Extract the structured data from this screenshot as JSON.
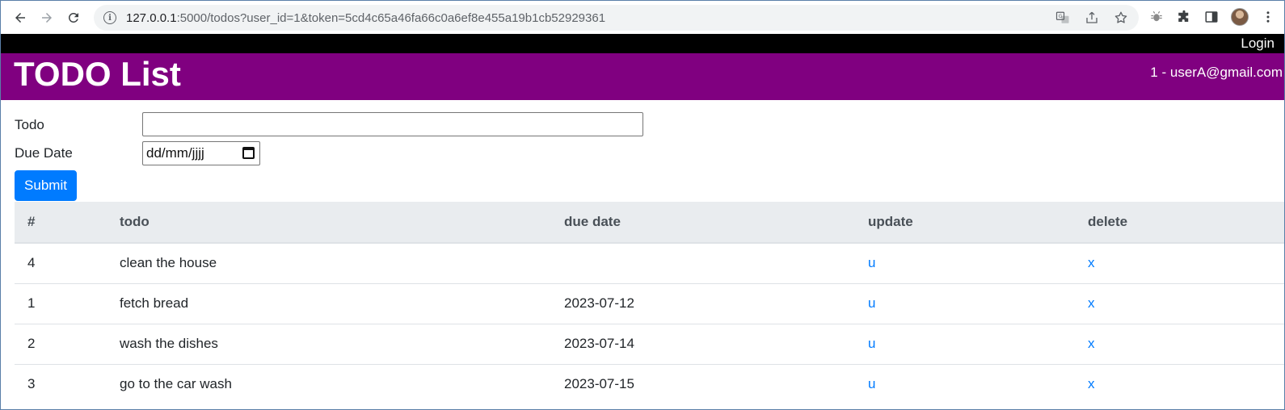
{
  "browser": {
    "url_host": "127.0.0.1",
    "url_rest": ":5000/todos?user_id=1&token=5cd4c65a46fa66c0a6ef8e455a19b1cb52929361",
    "omnibox_icons": [
      "translate-icon",
      "share-icon",
      "star-icon"
    ],
    "extension_icons": [
      "bug-extension-icon",
      "puzzle-extensions-icon",
      "side-panel-icon",
      "avatar",
      "more-menu-icon"
    ]
  },
  "topbar": {
    "login_label": "Login"
  },
  "header": {
    "title": "TODO List",
    "user_info": "1 - userA@gmail.com"
  },
  "form": {
    "todo_label": "Todo",
    "todo_value": "",
    "due_label": "Due Date",
    "due_placeholder": "dd/mm/jjjj",
    "submit_label": "Submit"
  },
  "table": {
    "headers": [
      "#",
      "todo",
      "due date",
      "update",
      "delete"
    ],
    "rows": [
      {
        "id": "4",
        "todo": "clean the house",
        "due": "",
        "update": "u",
        "delete": "x"
      },
      {
        "id": "1",
        "todo": "fetch bread",
        "due": "2023-07-12",
        "update": "u",
        "delete": "x"
      },
      {
        "id": "2",
        "todo": "wash the dishes",
        "due": "2023-07-14",
        "update": "u",
        "delete": "x"
      },
      {
        "id": "3",
        "todo": "go to the car wash",
        "due": "2023-07-15",
        "update": "u",
        "delete": "x"
      }
    ]
  },
  "colors": {
    "header_bg": "#800080",
    "topbar_bg": "#000000",
    "primary": "#007bff",
    "table_head_bg": "#e9ecef"
  }
}
